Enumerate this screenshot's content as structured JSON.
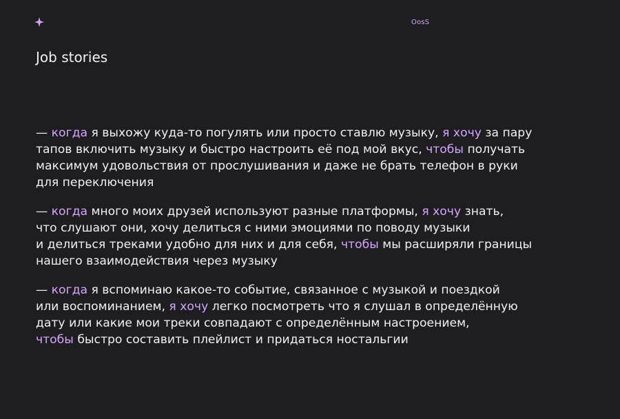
{
  "brand": {
    "logo_icon": "four-point-star-icon",
    "name": "OosS",
    "accent_color": "#d6a6ff"
  },
  "page": {
    "title": "Job stories"
  },
  "stories": [
    {
      "lines": [
        [
          "— ",
          {
            "hl": "когда"
          },
          " я выхожу куда-то погулять или просто ставлю музыку, ",
          {
            "hl": "я хочу"
          },
          " за пару"
        ],
        [
          "тапов включить музыку и быстро настроить её под мой вкус, ",
          {
            "hl": "чтобы"
          },
          " получать"
        ],
        [
          "максимум удовольствия от прослушивания и даже не брать телефон в руки"
        ],
        [
          "для переключения"
        ]
      ]
    },
    {
      "lines": [
        [
          "— ",
          {
            "hl": "когда"
          },
          " много моих друзей используют разные платформы, ",
          {
            "hl": "я хочу"
          },
          " знать,"
        ],
        [
          "что слушают они, хочу делиться с ними эмоциями по поводу музыки"
        ],
        [
          "и делиться треками удобно для них и для себя, ",
          {
            "hl": "чтобы"
          },
          " мы расширяли границы"
        ],
        [
          "нашего взаимодействия через музыку"
        ]
      ]
    },
    {
      "lines": [
        [
          "— ",
          {
            "hl": "когда"
          },
          " я вспоминаю какое-то событие, связанное с музыкой и поездкой"
        ],
        [
          "или воспоминанием, ",
          {
            "hl": "я хочу"
          },
          " легко посмотреть что я слушал в определённую"
        ],
        [
          "дату или какие мои треки совпадают с определённым настроением,"
        ],
        [
          {
            "hl": "чтобы"
          },
          " быстро составить плейлист и придаться ностальгии"
        ]
      ]
    }
  ]
}
